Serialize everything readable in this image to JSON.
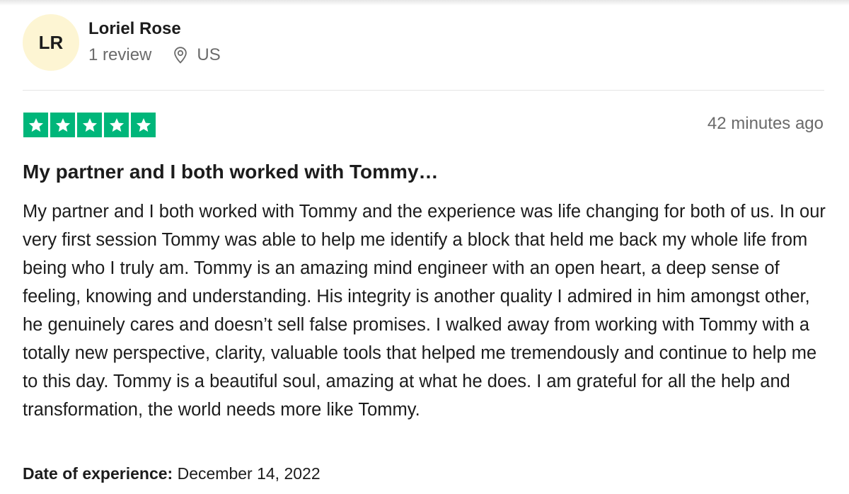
{
  "reviewer": {
    "initials": "LR",
    "name": "Loriel Rose",
    "review_count": "1 review",
    "country": "US"
  },
  "review": {
    "rating": 5,
    "rating_max": 5,
    "star_color": "#00b67a",
    "posted": "42 minutes ago",
    "title": "My partner and I both worked with Tommy…",
    "body": "My partner and I both worked with Tommy and the experience was life changing for both of us. In our very first session Tommy was able to help me identify a block that held me back my whole life from being who I truly am. Tommy is an amazing mind engineer with an open heart, a deep sense of feeling, knowing and understanding. His integrity is another quality I admired in him amongst other, he genuinely cares and doesn’t sell false promises. I walked away from working with Tommy with a totally new perspective, clarity, valuable tools that helped me tremendously and continue to help me to this day. Tommy is a beautiful soul, amazing at what he does. I am grateful for all the help and transformation, the world needs more like Tommy.",
    "experience_label": "Date of experience:",
    "experience_date": "December 14, 2022"
  },
  "icons": {
    "location": "location-pin-icon",
    "star": "star-icon"
  },
  "colors": {
    "avatar_bg": "#fdf5d3",
    "muted_text": "#6b6b6b"
  }
}
